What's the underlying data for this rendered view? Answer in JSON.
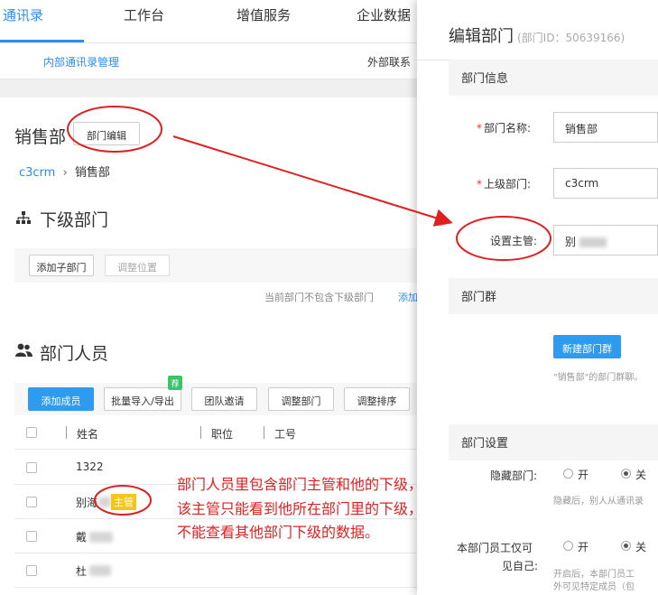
{
  "nav": {
    "tabs": [
      "通讯录",
      "工作台",
      "增值服务",
      "企业数据"
    ],
    "sub_tabs": [
      "内部通讯录管理",
      "外部联系"
    ]
  },
  "department": {
    "name": "销售部",
    "edit_button": "部门编辑",
    "breadcrumb": {
      "root": "c3crm",
      "separator": "›",
      "current": "销售部"
    }
  },
  "sub_departments": {
    "title": "下级部门",
    "add_button": "添加子部门",
    "move_button": "调整位置",
    "empty_text": "当前部门不包含下级部门",
    "add_link": "添加"
  },
  "members": {
    "title": "部门人员",
    "buttons": {
      "add": "添加成员",
      "import_export": "批量导入/导出",
      "invite": "团队邀请",
      "change_dept": "调整部门",
      "reorder": "调整排序"
    },
    "badge": "荐",
    "columns": {
      "name": "姓名",
      "position": "职位",
      "job_no": "工号"
    },
    "rows": [
      {
        "name": "1322",
        "tag": ""
      },
      {
        "name": "别海",
        "tag": "主管"
      },
      {
        "name": "戴",
        "tag": ""
      },
      {
        "name": "杜",
        "tag": ""
      }
    ]
  },
  "annotation": {
    "lines": [
      "部门人员里包含部门主管和他的下级，",
      "该主管只能看到他所在部门里的下级，",
      "不能查看其他部门下级的数据。"
    ]
  },
  "panel": {
    "title": "编辑部门",
    "dept_id": "(部门ID：50639166)",
    "info_section": "部门信息",
    "name_label": "部门名称:",
    "name_value": "销售部",
    "parent_label": "上级部门:",
    "parent_value": "c3crm",
    "manager_label": "设置主管:",
    "manager_value": "别",
    "group_section": "部门群",
    "new_group_button": "新建部门群",
    "group_hint": "\"销售部\"的部门群聊。",
    "settings_section": "部门设置",
    "hide_label": "隐藏部门:",
    "option_on": "开",
    "option_off": "关",
    "hide_hint": "隐藏后，别人从通讯录",
    "visible_label_1": "本部门员工仅可",
    "visible_label_2": "见自己:",
    "visible_hint_1": "开启后，本部门员工",
    "visible_hint_2": "外可见特定成员（包"
  },
  "colors": {
    "accent": "#2d8cf0",
    "annotation_red": "#e02020",
    "tag_yellow": "#f5c518",
    "badge_green": "#3cc46b"
  }
}
